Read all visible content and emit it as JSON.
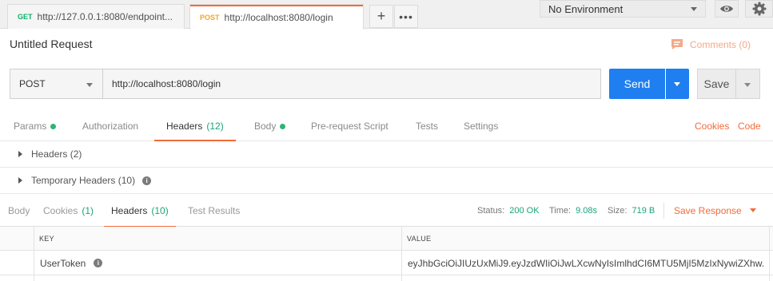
{
  "tabs": [
    {
      "method": "GET",
      "url": "http://127.0.0.1:8080/endpoint..."
    },
    {
      "method": "POST",
      "url": "http://localhost:8080/login"
    }
  ],
  "tab_actions": {
    "add": "+",
    "more": "•••"
  },
  "environment": {
    "selected": "No Environment"
  },
  "request": {
    "title": "Untitled Request",
    "comments_label": "Comments (0)",
    "method": "POST",
    "url": "http://localhost:8080/login",
    "send_label": "Send",
    "save_label": "Save"
  },
  "request_tabs": [
    {
      "label": "Params",
      "dot": true
    },
    {
      "label": "Authorization"
    },
    {
      "label": "Headers",
      "count": "(12)",
      "active": true
    },
    {
      "label": "Body",
      "dot": true
    },
    {
      "label": "Pre-request Script"
    },
    {
      "label": "Tests"
    },
    {
      "label": "Settings"
    }
  ],
  "request_links": {
    "cookies": "Cookies",
    "code": "Code"
  },
  "header_groups": [
    {
      "label": "Headers",
      "count": "(2)"
    },
    {
      "label": "Temporary Headers",
      "count": "(10)",
      "info": "i"
    }
  ],
  "response_tabs": [
    {
      "label": "Body"
    },
    {
      "label": "Cookies",
      "count": "(1)"
    },
    {
      "label": "Headers",
      "count": "(10)",
      "active": true
    },
    {
      "label": "Test Results"
    }
  ],
  "response_meta": {
    "status_label": "Status:",
    "status_value": "200 OK",
    "time_label": "Time:",
    "time_value": "9.08s",
    "size_label": "Size:",
    "size_value": "719 B",
    "save_response": "Save Response"
  },
  "table": {
    "columns": [
      "KEY",
      "VALUE"
    ],
    "rows": [
      {
        "key": "UserToken",
        "info": "i",
        "value": "eyJhbGciOiJIUzUxMiJ9.eyJzdWIiOiJwLXcwNyIsImlhdCI6MTU5MjI5MzIxNywiZXhw..."
      }
    ]
  },
  "colors": {
    "accent": "#f26b3a",
    "primary": "#1f7ff0",
    "success": "#1aa37a"
  }
}
